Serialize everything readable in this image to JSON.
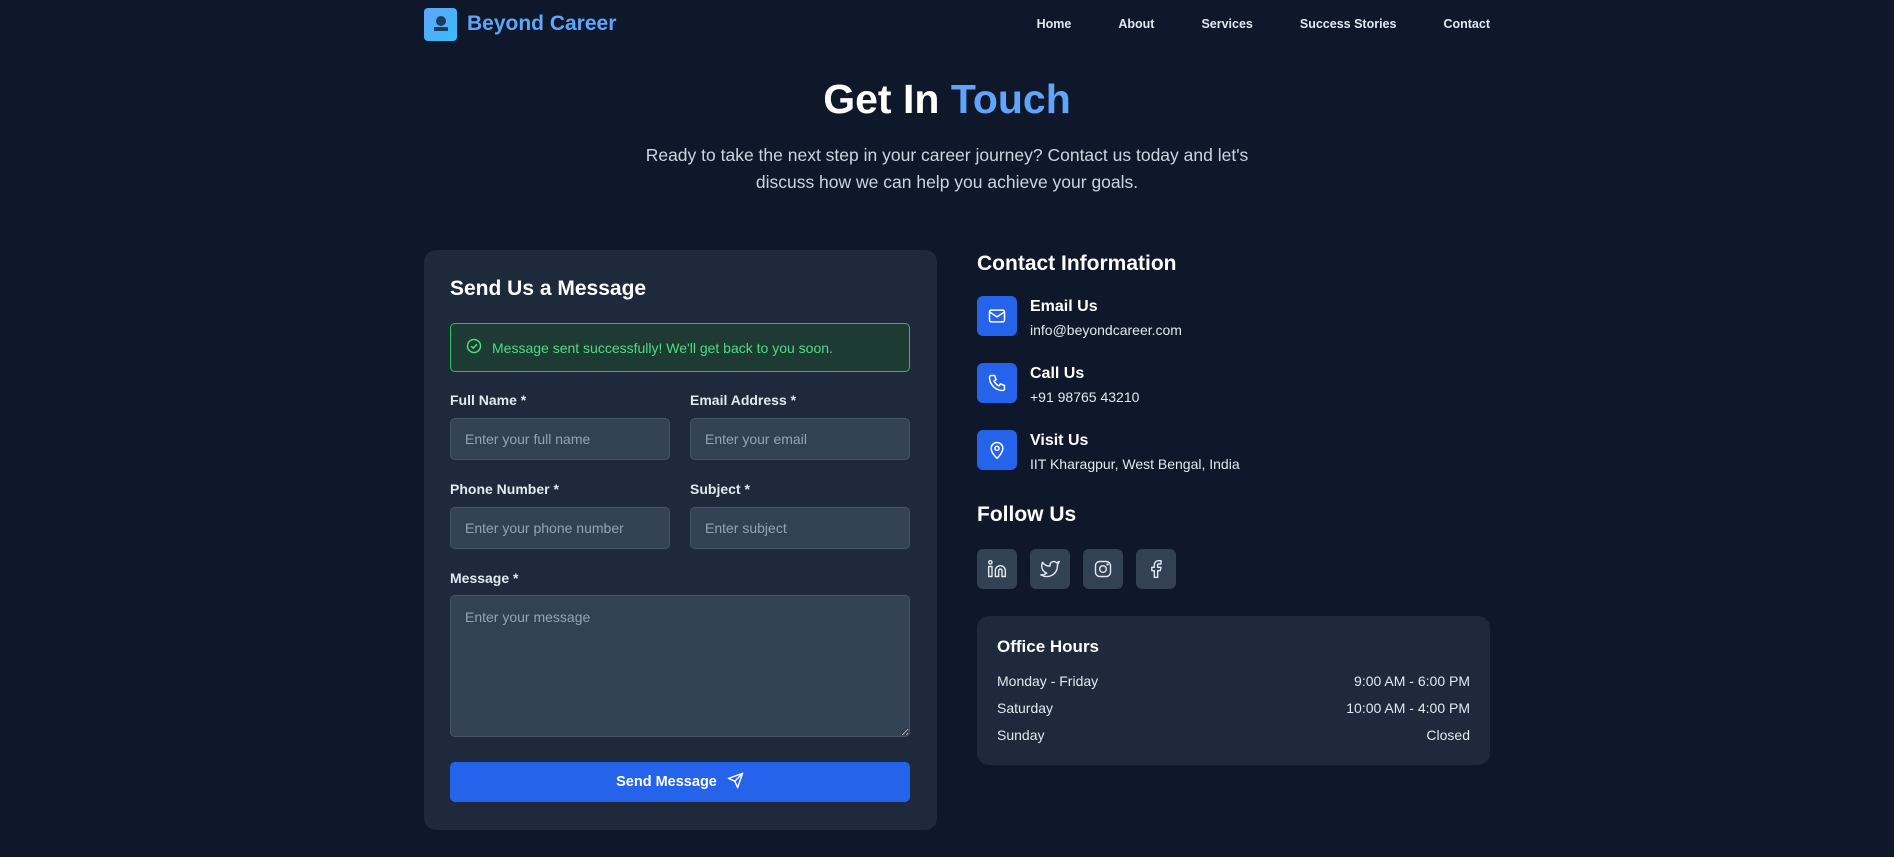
{
  "nav": {
    "brand": "Beyond Career",
    "links": [
      "Home",
      "About",
      "Services",
      "Success Stories",
      "Contact"
    ]
  },
  "hero": {
    "title_part1": "Get In",
    "title_accent": "Touch",
    "subtitle": "Ready to take the next step in your career journey? Contact us today and let's discuss how we can help you achieve your goals."
  },
  "form": {
    "title": "Send Us a Message",
    "alert": "Message sent successfully! We'll get back to you soon.",
    "full_name_label": "Full Name *",
    "full_name_placeholder": "Enter your full name",
    "email_label": "Email Address *",
    "email_placeholder": "Enter your email",
    "phone_label": "Phone Number *",
    "phone_placeholder": "Enter your phone number",
    "subject_label": "Subject *",
    "subject_placeholder": "Enter subject",
    "message_label": "Message *",
    "message_placeholder": "Enter your message",
    "submit_label": "Send Message"
  },
  "contact": {
    "title": "Contact Information",
    "email_head": "Email Us",
    "email_value": "info@beyondcareer.com",
    "call_head": "Call Us",
    "call_value": "+91 98765 43210",
    "visit_head": "Visit Us",
    "visit_value": "IIT Kharagpur, West Bengal, India"
  },
  "follow": {
    "title": "Follow Us",
    "icons": [
      "linkedin-icon",
      "twitter-icon",
      "instagram-icon",
      "facebook-icon"
    ]
  },
  "hours": {
    "title": "Office Hours",
    "rows": [
      {
        "day": "Monday - Friday",
        "time": "9:00 AM - 6:00 PM"
      },
      {
        "day": "Saturday",
        "time": "10:00 AM - 4:00 PM"
      },
      {
        "day": "Sunday",
        "time": "Closed"
      }
    ]
  },
  "colors": {
    "background": "#0f172a",
    "card": "#1e293b",
    "accent": "#60a5fa",
    "primary": "#2563eb",
    "success": "#4ade80"
  }
}
